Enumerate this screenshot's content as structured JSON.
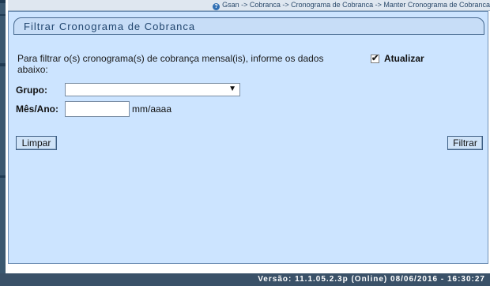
{
  "breadcrumb": {
    "text": "Gsan -> Cobranca -> Cronograma de Cobranca -> Manter Cronograma de Cobranca"
  },
  "panel": {
    "title": "Filtrar Cronograma de Cobranca",
    "intro": "Para filtrar o(s) cronograma(s) de cobrança mensal(is), informe os dados abaixo:",
    "update": {
      "label": "Atualizar",
      "checked": true
    }
  },
  "form": {
    "group_label": "Grupo:",
    "group_value": "",
    "month_label": "Mês/Ano:",
    "month_value": "",
    "month_hint": "mm/aaaa"
  },
  "buttons": {
    "clear": "Limpar",
    "filter": "Filtrar"
  },
  "footer": {
    "version": "Versão: 11.1.05.2.3p (Online) 08/06/2016 - 16:30:27"
  }
}
